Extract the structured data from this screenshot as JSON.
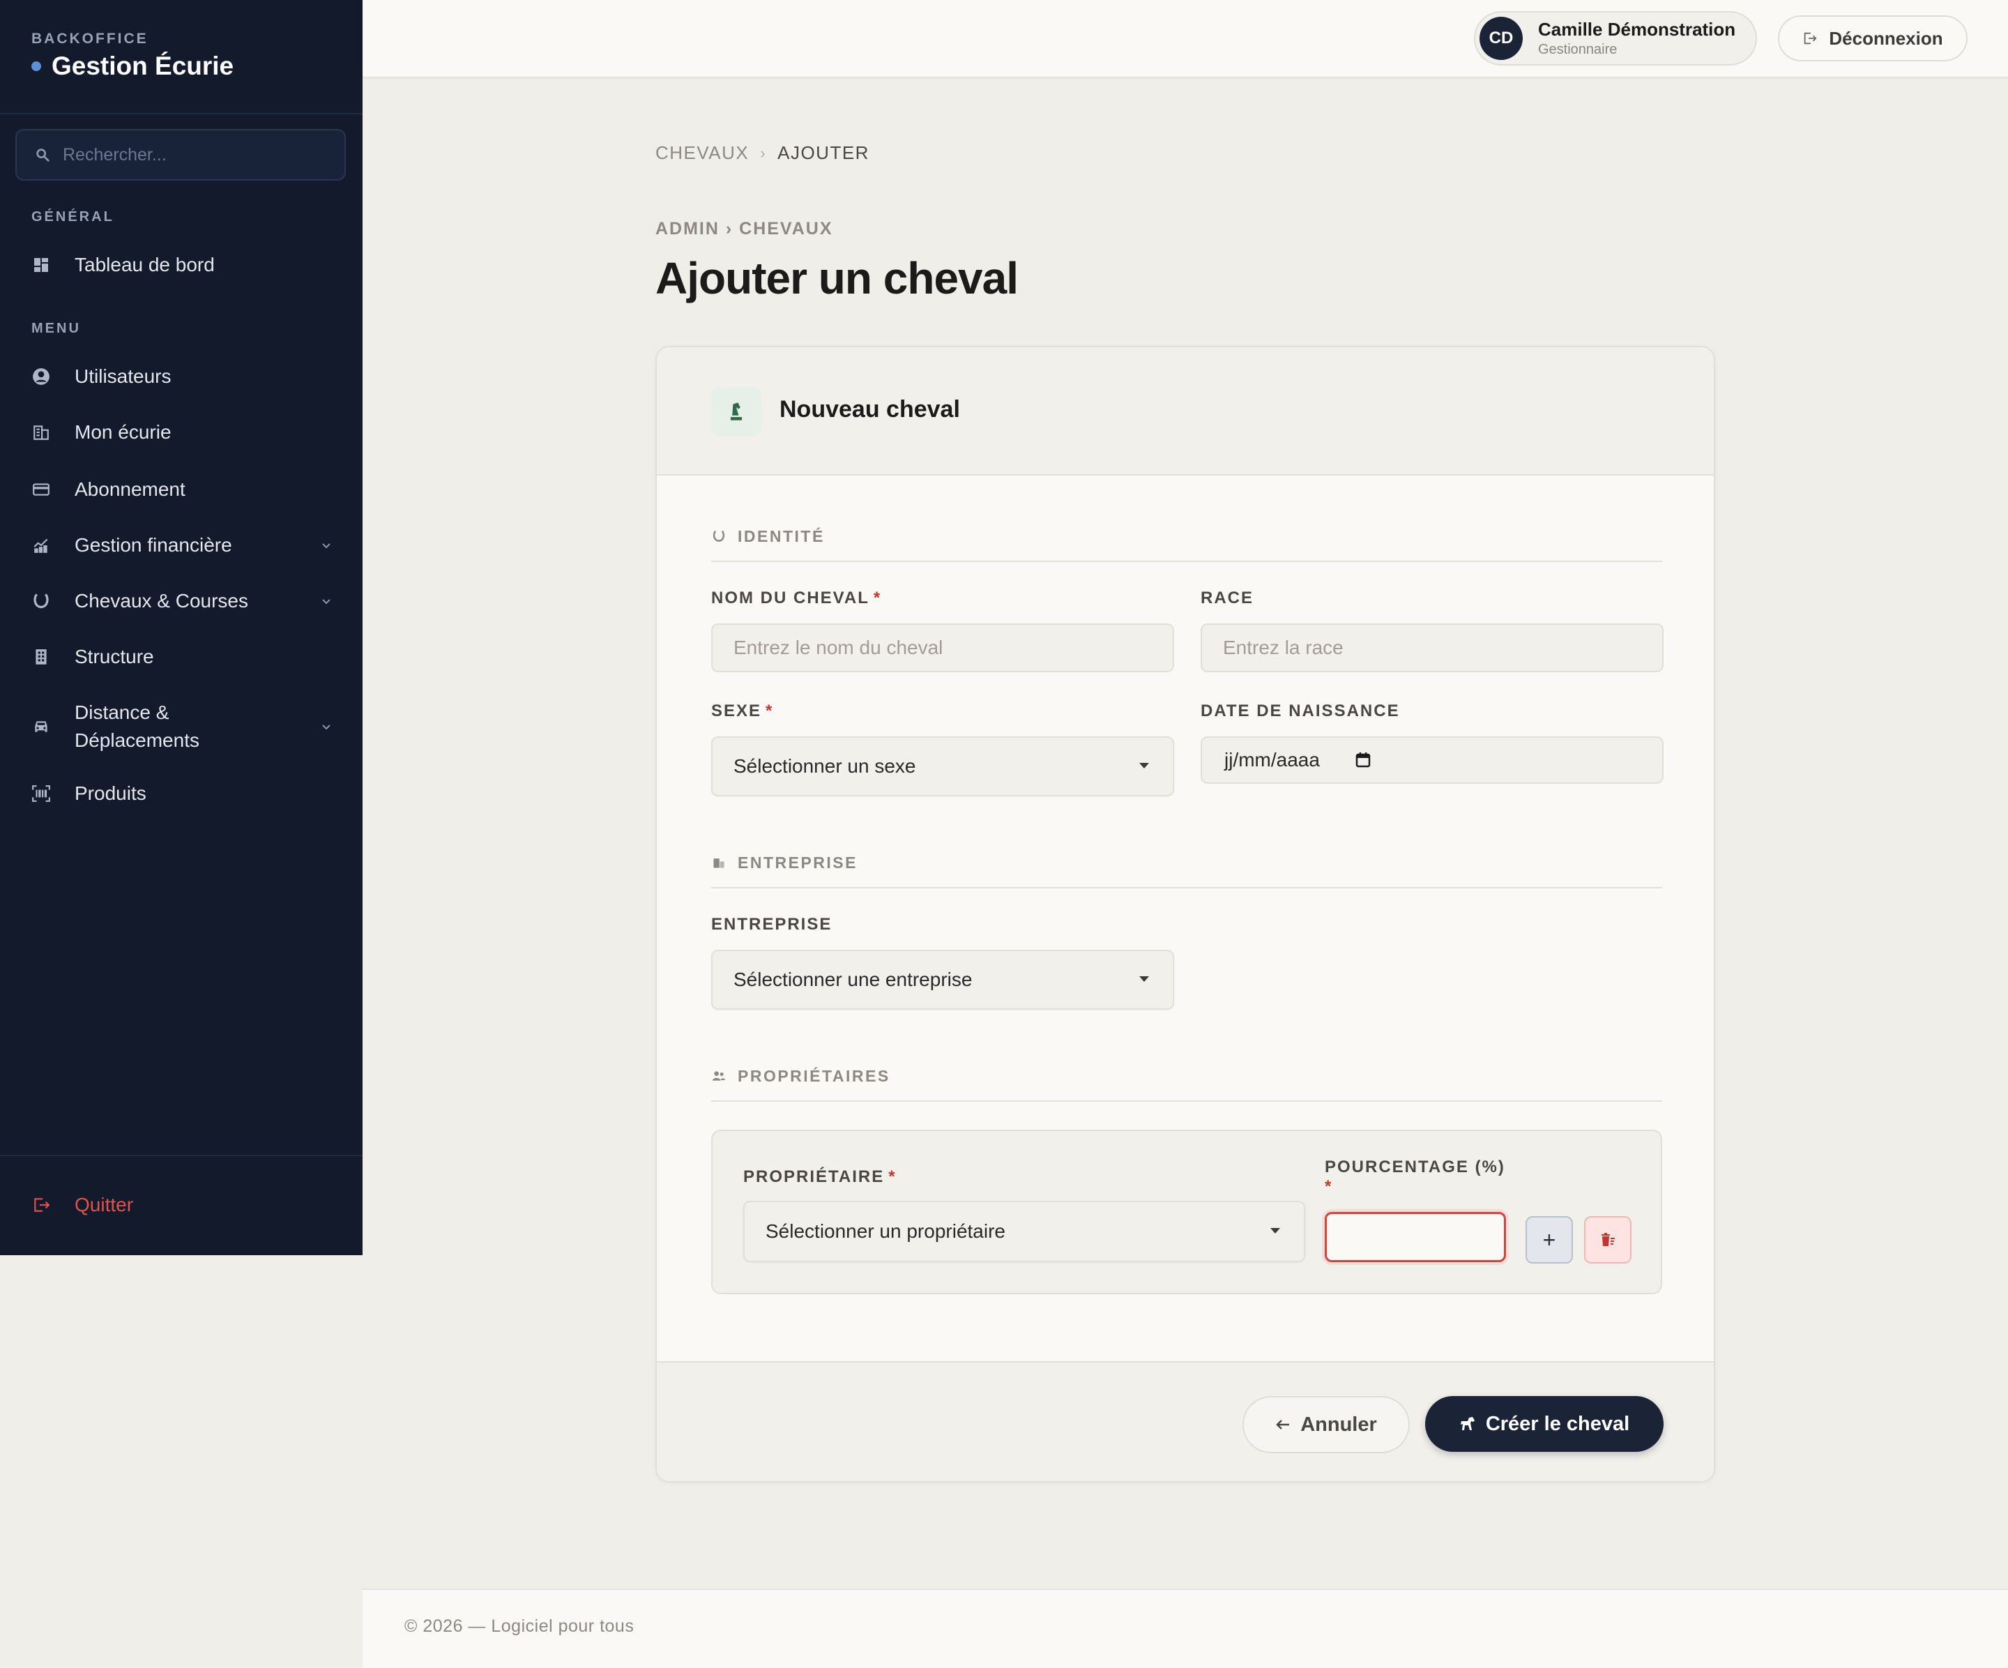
{
  "sidebar": {
    "brand_kicker": "BACKOFFICE",
    "brand_title": "Gestion Écurie",
    "search_placeholder": "Rechercher...",
    "section_general": "GÉNÉRAL",
    "section_menu": "MENU",
    "items": [
      {
        "label": "Tableau de bord",
        "icon": "dashboard-icon"
      },
      {
        "label": "Utilisateurs",
        "icon": "user-circle-icon"
      },
      {
        "label": "Mon écurie",
        "icon": "building-icon"
      },
      {
        "label": "Abonnement",
        "icon": "credit-card-icon"
      },
      {
        "label": "Gestion financière",
        "icon": "finance-icon",
        "expandable": true
      },
      {
        "label": "Chevaux & Courses",
        "icon": "horseshoe-icon",
        "expandable": true
      },
      {
        "label": "Structure",
        "icon": "office-building-icon"
      },
      {
        "label": "Distance & Déplacements",
        "label_line1": "Distance &",
        "label_line2": "Déplacements",
        "icon": "car-icon",
        "expandable": true
      },
      {
        "label": "Produits",
        "icon": "barcode-icon"
      }
    ],
    "quit_label": "Quitter"
  },
  "topbar": {
    "user_initials": "CD",
    "user_name": "Camille Démonstration",
    "user_role": "Gestionnaire",
    "logout_label": "Déconnexion"
  },
  "breadcrumb": {
    "parent": "CHEVAUX",
    "current": "AJOUTER"
  },
  "page": {
    "kicker": "ADMIN › CHEVAUX",
    "title": "Ajouter un cheval"
  },
  "form": {
    "card_title": "Nouveau cheval",
    "section_identity": "IDENTITÉ",
    "name_label": "NOM DU CHEVAL",
    "name_placeholder": "Entrez le nom du cheval",
    "race_label": "RACE",
    "race_placeholder": "Entrez la race",
    "sex_label": "SEXE",
    "sex_value": "Sélectionner un sexe",
    "birth_label": "DATE DE NAISSANCE",
    "birth_value": "jj/mm/aaaa",
    "section_company": "ENTREPRISE",
    "company_label": "ENTREPRISE",
    "company_value": "Sélectionner une entreprise",
    "section_owners": "PROPRIÉTAIRES",
    "owner_label": "PROPRIÉTAIRE",
    "owner_value": "Sélectionner un propriétaire",
    "percent_label": "POURCENTAGE (%)",
    "required_mark": "*",
    "add_symbol": "+",
    "cancel_label": "Annuler",
    "create_label": "Créer le cheval"
  },
  "footer": {
    "text": "© 2026 — Logiciel pour tous"
  },
  "colors": {
    "sidebar_bg": "#121a2c",
    "accent_dark": "#1b2437",
    "required": "#c8332c",
    "page_bg": "#f0eee9"
  }
}
